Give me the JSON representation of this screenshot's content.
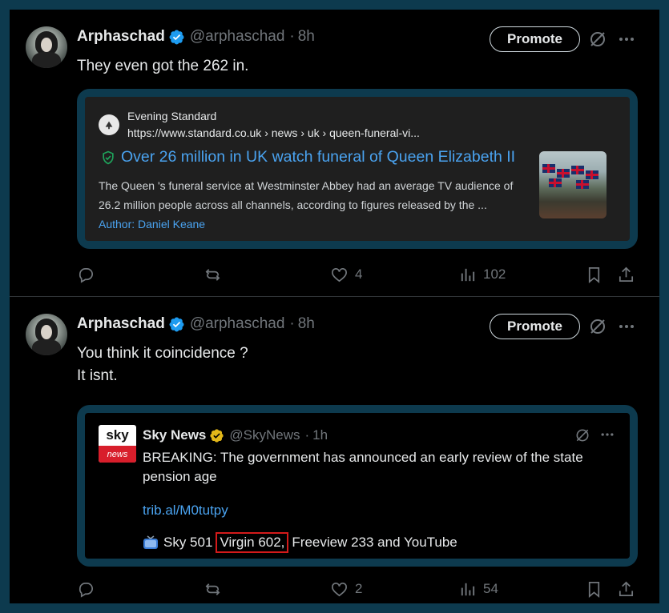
{
  "posts": [
    {
      "author": {
        "name": "Arphaschad",
        "handle": "@arphaschad",
        "time": "8h"
      },
      "promote_label": "Promote",
      "text_lines": [
        "They even got the 262 in."
      ],
      "link_card": {
        "source": "Evening Standard",
        "url": "https://www.standard.co.uk › news › uk › queen-funeral-vi...",
        "headline": "Over 26 million in UK watch funeral of Queen Elizabeth II",
        "description": "The Queen 's funeral service at Westminster Abbey had an average TV audience of 26.2 million people across all channels, according to figures released by the ...",
        "author": "Author: Daniel Keane"
      },
      "stats": {
        "replies": "",
        "reposts": "",
        "likes": "4",
        "views": "102"
      }
    },
    {
      "author": {
        "name": "Arphaschad",
        "handle": "@arphaschad",
        "time": "8h"
      },
      "promote_label": "Promote",
      "text_lines": [
        "You think it coincidence ?",
        "It isnt."
      ],
      "quote": {
        "name": "Sky News",
        "handle": "@SkyNews",
        "time": "1h",
        "logo_top": "sky",
        "logo_bottom": "news",
        "text": "BREAKING: The government has announced an early review of the state pension age",
        "link": "trib.al/M0tutpy",
        "channels_before": "Sky 501",
        "channels_highlight": "Virgin 602,",
        "channels_after": "Freeview 233 and YouTube"
      },
      "stats": {
        "replies": "",
        "reposts": "",
        "likes": "2",
        "views": "54"
      }
    }
  ],
  "separator": "·",
  "colors": {
    "background": "#000000",
    "accent": "#4aa3f0",
    "frame": "#0d3a4e",
    "verified_blue": "#1d9bf0",
    "verified_gold": "#e2b719",
    "highlight_box": "#d41a1a"
  },
  "icons": [
    "verified-badge-icon",
    "grok-icon",
    "more-icon",
    "reply-icon",
    "repost-icon",
    "like-icon",
    "views-icon",
    "bookmark-icon",
    "share-icon",
    "shield-check-icon",
    "tv-icon"
  ]
}
